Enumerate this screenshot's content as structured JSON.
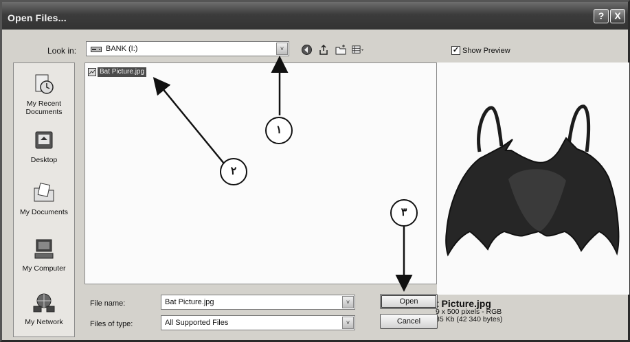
{
  "window": {
    "title": "Open Files...",
    "help_label": "?",
    "close_label": "X"
  },
  "toolbar": {
    "lookin_label": "Look in:",
    "lookin_value": "BANK (I:)",
    "dropdown_arrow": "˅",
    "tools": [
      "back-icon",
      "up-folder-icon",
      "new-folder-icon",
      "views-menu-icon"
    ]
  },
  "preview_toggle": {
    "label": "Show Preview",
    "checked_mark": "✓"
  },
  "places": [
    {
      "label": "My Recent Documents",
      "icon": "recent-documents-icon"
    },
    {
      "label": "Desktop",
      "icon": "desktop-icon"
    },
    {
      "label": "My Documents",
      "icon": "my-documents-icon"
    },
    {
      "label": "My Computer",
      "icon": "my-computer-icon"
    },
    {
      "label": "My Network",
      "icon": "my-network-icon"
    }
  ],
  "files": [
    {
      "name": "Bat Picture.jpg",
      "selected": true
    }
  ],
  "preview": {
    "name": "t Picture.jpg",
    "dimensions": "9 x 500 pixels - RGB",
    "size": "35 Kb (42 340 bytes)"
  },
  "form": {
    "filename_label": "File name:",
    "filename_value": "Bat Picture.jpg",
    "filetype_label": "Files of type:",
    "filetype_value": "All Supported Files",
    "open_label": "Open",
    "cancel_label": "Cancel"
  },
  "annotations": [
    {
      "label": "١"
    },
    {
      "label": "٢"
    },
    {
      "label": "٣"
    }
  ]
}
